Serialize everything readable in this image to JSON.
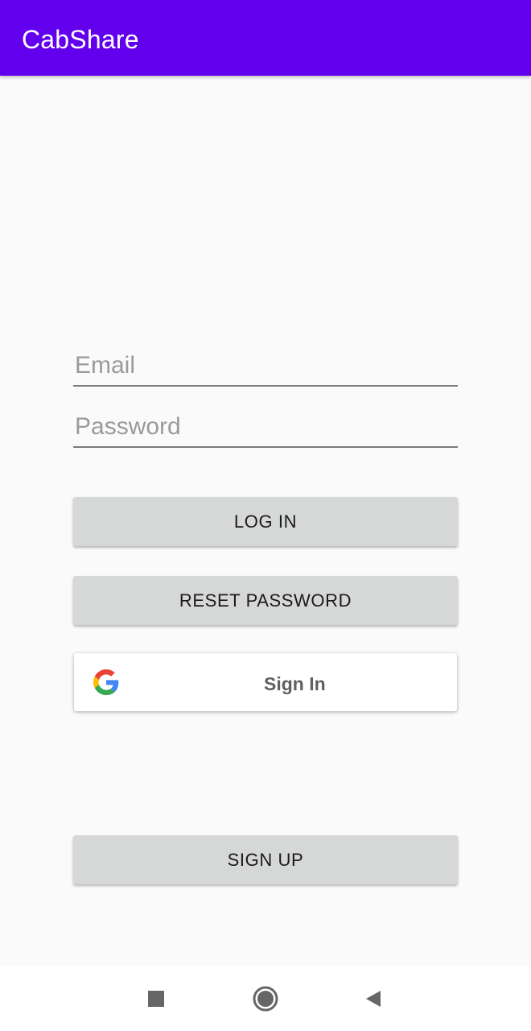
{
  "app_bar": {
    "title": "CabShare",
    "color": "#6200ee"
  },
  "form": {
    "email_placeholder": "Email",
    "email_value": "",
    "password_placeholder": "Password",
    "password_value": ""
  },
  "buttons": {
    "login_label": "LOG IN",
    "reset_password_label": "RESET PASSWORD",
    "google_sign_in_label": "Sign In",
    "sign_up_label": "SIGN UP"
  },
  "icons": {
    "google": "google-g-icon",
    "recents": "square-recents-icon",
    "home": "circle-home-icon",
    "back": "triangle-back-icon"
  }
}
